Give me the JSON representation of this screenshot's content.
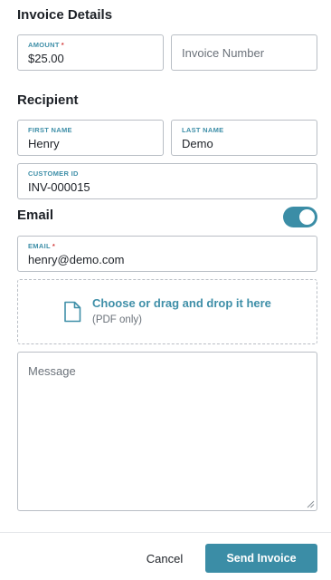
{
  "invoice_details": {
    "title": "Invoice Details",
    "amount": {
      "label": "AMOUNT",
      "required": "*",
      "value": "$25.00"
    },
    "invoice_number": {
      "placeholder": "Invoice Number"
    }
  },
  "recipient": {
    "title": "Recipient",
    "first_name": {
      "label": "FIRST NAME",
      "value": "Henry"
    },
    "last_name": {
      "label": "LAST NAME",
      "value": "Demo"
    },
    "customer_id": {
      "label": "CUSTOMER ID",
      "value": "INV-000015"
    }
  },
  "email": {
    "title": "Email",
    "toggle_on": true,
    "field": {
      "label": "EMAIL",
      "required": "*",
      "value": "henry@demo.com"
    }
  },
  "attachment": {
    "icon": "file-icon",
    "title": "Choose or drag and drop it here",
    "subtitle": "(PDF only)"
  },
  "message": {
    "placeholder": "Message"
  },
  "footer": {
    "cancel_label": "Cancel",
    "send_label": "Send Invoice"
  },
  "colors": {
    "accent": "#3b8da6",
    "label_accent": "#3f8fa8",
    "required": "#d23a3a",
    "border": "#b9bec5"
  }
}
